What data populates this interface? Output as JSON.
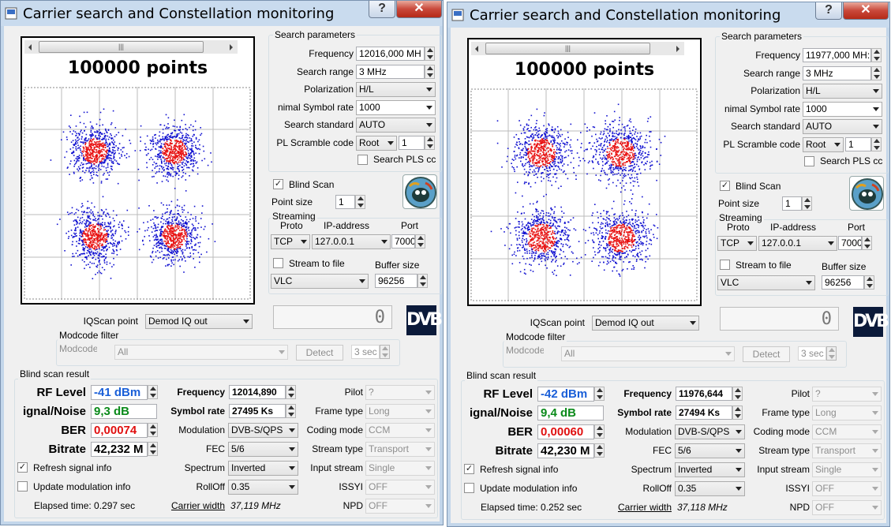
{
  "windows": [
    {
      "title": "Carrier search and Constellation monitoring",
      "points_label": "100000 points",
      "search_parameters": {
        "caption": "Search parameters",
        "frequency_label": "Frequency",
        "frequency_value": "12016,000 MH",
        "search_range_label": "Search range",
        "search_range_value": "3 MHz",
        "polarization_label": "Polarization",
        "polarization_value": "H/L",
        "symbol_rate_label": "nimal Symbol rate",
        "symbol_rate_value": "1000",
        "search_standard_label": "Search standard",
        "search_standard_value": "AUTO",
        "pl_scramble_label": "PL Scramble code",
        "pl_scramble_mode": "Root",
        "pl_scramble_value": "1",
        "search_pls_label": "Search PLS cc"
      },
      "blind_scan_label": "Blind Scan",
      "point_size_label": "Point size",
      "point_size_value": "1",
      "streaming": {
        "caption": "Streaming",
        "proto_label": "Proto",
        "proto_value": "TCP",
        "ip_label": "IP-address",
        "ip_value": "127.0.0.1",
        "port_label": "Port",
        "port_value": "7000",
        "stream_to_file_label": "Stream to file",
        "buffer_size_label": "Buffer size",
        "buffer_size_value": "96256",
        "player_value": "VLC"
      },
      "iqscan_label": "IQScan point",
      "iqscan_value": "Demod IQ out",
      "lcd_value": "0",
      "dvb_logo": "DVB",
      "modcode": {
        "caption": "Modcode filter",
        "label": "Modcode",
        "value": "All",
        "detect": "Detect",
        "interval": "3 sec"
      },
      "result": {
        "caption": "Blind scan result",
        "rf_level_label": "RF Level",
        "rf_level_value": "-41 dBm",
        "snr_label": "ignal/Noise",
        "snr_value": "9,3 dB",
        "ber_label": "BER",
        "ber_value": "0,00074",
        "bitrate_label": "Bitrate",
        "bitrate_value": "42,232 M",
        "frequency_label": "Frequency",
        "frequency_value": "12014,890",
        "symbol_rate_label": "Symbol rate",
        "symbol_rate_value": "27495 Ks",
        "modulation_label": "Modulation",
        "modulation_value": "DVB-S/QPS",
        "fec_label": "FEC",
        "fec_value": "5/6",
        "spectrum_label": "Spectrum",
        "spectrum_value": "Inverted",
        "rolloff_label": "RollOff",
        "rolloff_value": "0.35",
        "carrier_width_label": "Carrier width",
        "carrier_width_value": "37,119 MHz",
        "pilot_label": "Pilot",
        "pilot_value": "?",
        "frame_type_label": "Frame type",
        "frame_type_value": "Long",
        "coding_mode_label": "Coding mode",
        "coding_mode_value": "CCM",
        "stream_type_label": "Stream type",
        "stream_type_value": "Transport",
        "input_stream_label": "Input stream",
        "input_stream_value": "Single",
        "issyi_label": "ISSYI",
        "issyi_value": "OFF",
        "npd_label": "NPD",
        "npd_value": "OFF",
        "refresh_label": "Refresh signal info",
        "update_mod_label": "Update modulation info",
        "elapsed": "Elapsed time: 0.297 sec"
      }
    },
    {
      "title": "Carrier search and Constellation monitoring",
      "points_label": "100000 points",
      "search_parameters": {
        "caption": "Search parameters",
        "frequency_label": "Frequency",
        "frequency_value": "11977,000 MH:",
        "search_range_label": "Search range",
        "search_range_value": "3 MHz",
        "polarization_label": "Polarization",
        "polarization_value": "H/L",
        "symbol_rate_label": "nimal Symbol rate",
        "symbol_rate_value": "1000",
        "search_standard_label": "Search standard",
        "search_standard_value": "AUTO",
        "pl_scramble_label": "PL Scramble code",
        "pl_scramble_mode": "Root",
        "pl_scramble_value": "1",
        "search_pls_label": "Search PLS cc"
      },
      "blind_scan_label": "Blind Scan",
      "point_size_label": "Point size",
      "point_size_value": "1",
      "streaming": {
        "caption": "Streaming",
        "proto_label": "Proto",
        "proto_value": "TCP",
        "ip_label": "IP-address",
        "ip_value": "127.0.0.1",
        "port_label": "Port",
        "port_value": "7000",
        "stream_to_file_label": "Stream to file",
        "buffer_size_label": "Buffer size",
        "buffer_size_value": "96256",
        "player_value": "VLC"
      },
      "iqscan_label": "IQScan point",
      "iqscan_value": "Demod IQ out",
      "lcd_value": "0",
      "dvb_logo": "DVB",
      "modcode": {
        "caption": "Modcode filter",
        "label": "Modcode",
        "value": "All",
        "detect": "Detect",
        "interval": "3 sec"
      },
      "result": {
        "caption": "Blind scan result",
        "rf_level_label": "RF Level",
        "rf_level_value": "-42 dBm",
        "snr_label": "ignal/Noise",
        "snr_value": "9,4 dB",
        "ber_label": "BER",
        "ber_value": "0,00060",
        "bitrate_label": "Bitrate",
        "bitrate_value": "42,230 M",
        "frequency_label": "Frequency",
        "frequency_value": "11976,644",
        "symbol_rate_label": "Symbol rate",
        "symbol_rate_value": "27494 Ks",
        "modulation_label": "Modulation",
        "modulation_value": "DVB-S/QPS",
        "fec_label": "FEC",
        "fec_value": "5/6",
        "spectrum_label": "Spectrum",
        "spectrum_value": "Inverted",
        "rolloff_label": "RollOff",
        "rolloff_value": "0.35",
        "carrier_width_label": "Carrier width",
        "carrier_width_value": "37,118 MHz",
        "pilot_label": "Pilot",
        "pilot_value": "?",
        "frame_type_label": "Frame type",
        "frame_type_value": "Long",
        "coding_mode_label": "Coding mode",
        "coding_mode_value": "CCM",
        "stream_type_label": "Stream type",
        "stream_type_value": "Transport",
        "input_stream_label": "Input stream",
        "input_stream_value": "Single",
        "issyi_label": "ISSYI",
        "issyi_value": "OFF",
        "npd_label": "NPD",
        "npd_value": "OFF",
        "refresh_label": "Refresh signal info",
        "update_mod_label": "Update modulation info",
        "elapsed": "Elapsed time: 0.252 sec"
      }
    }
  ],
  "colors": {
    "rf_blue": "#1a5fd8",
    "snr_green": "#0a8a1a",
    "ber_red": "#e01010",
    "dot_blue": "#1010d0",
    "dot_red": "#e81010"
  }
}
